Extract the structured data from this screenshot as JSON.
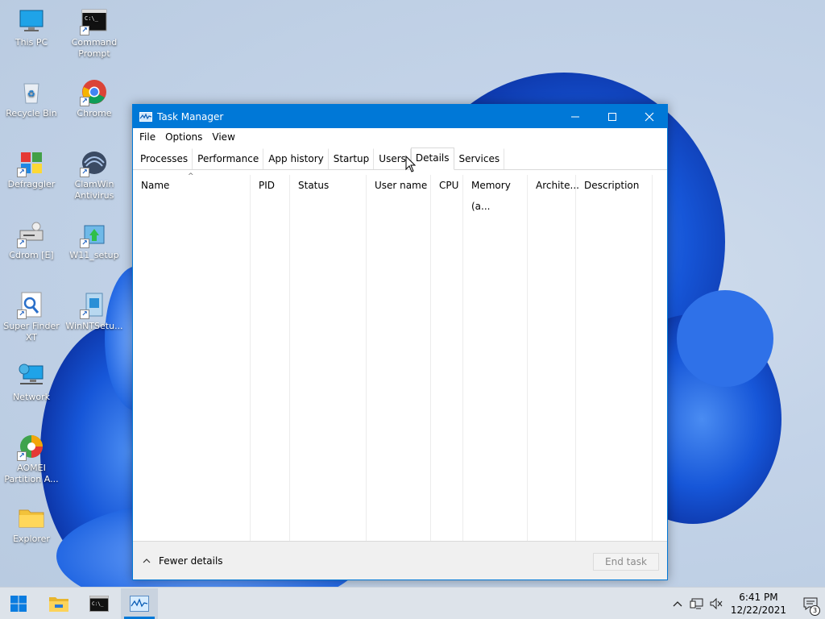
{
  "desktop": {
    "icons": [
      {
        "label": "This PC",
        "icon": "monitor-icon"
      },
      {
        "label": "Command Prompt",
        "icon": "command-prompt-icon"
      },
      {
        "label": "Recycle Bin",
        "icon": "recycle-bin-icon"
      },
      {
        "label": "Chrome",
        "icon": "chrome-icon"
      },
      {
        "label": "Defraggler",
        "icon": "defraggler-icon"
      },
      {
        "label": "ClamWin Antivirus",
        "icon": "clamwin-icon"
      },
      {
        "label": "Cdrom [E]",
        "icon": "cdrom-icon"
      },
      {
        "label": "W11_setup",
        "icon": "setup-icon"
      },
      {
        "label": "Super Finder XT",
        "icon": "super-finder-icon"
      },
      {
        "label": "WinNTSetu...",
        "icon": "winntsetup-icon"
      },
      {
        "label": "Network",
        "icon": "network-icon"
      },
      {
        "label": "AOMEI Partition A...",
        "icon": "aomei-icon"
      },
      {
        "label": "Explorer",
        "icon": "folder-icon"
      }
    ]
  },
  "window": {
    "title": "Task Manager",
    "menu": [
      "File",
      "Options",
      "View"
    ],
    "tabs": [
      {
        "label": "Processes",
        "active": false
      },
      {
        "label": "Performance",
        "active": false
      },
      {
        "label": "App history",
        "active": false
      },
      {
        "label": "Startup",
        "active": false
      },
      {
        "label": "Users",
        "active": false
      },
      {
        "label": "Details",
        "active": true
      },
      {
        "label": "Services",
        "active": false
      }
    ],
    "columns": [
      "Name",
      "PID",
      "Status",
      "User name",
      "CPU",
      "Memory (a...",
      "Archite...",
      "Description"
    ],
    "sort_glyph": "^",
    "footer": {
      "fewer_details": "Fewer details",
      "end_task": "End task"
    }
  },
  "taskbar": {
    "clock_time": "6:41 PM",
    "clock_date": "12/22/2021",
    "notification_count": "3",
    "accent": "#0078d7"
  }
}
